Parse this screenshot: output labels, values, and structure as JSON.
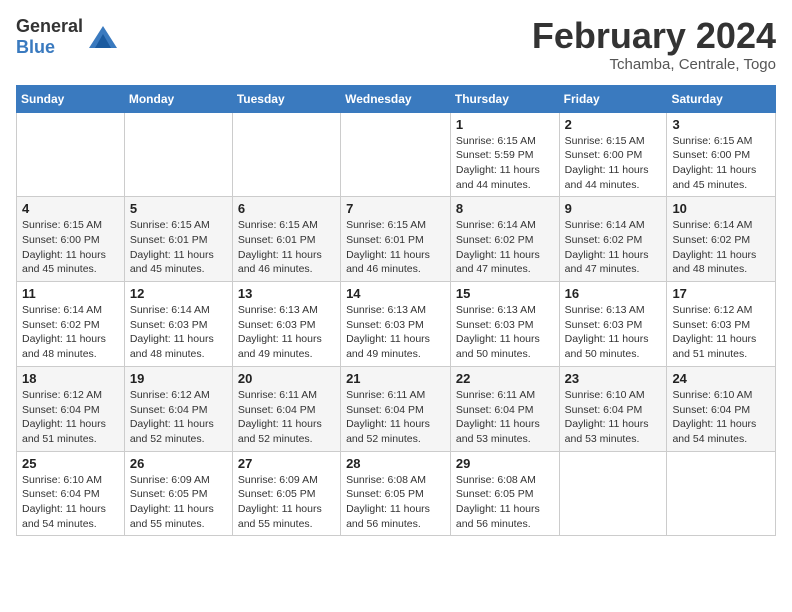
{
  "header": {
    "logo_general": "General",
    "logo_blue": "Blue",
    "month_title": "February 2024",
    "location": "Tchamba, Centrale, Togo"
  },
  "days_of_week": [
    "Sunday",
    "Monday",
    "Tuesday",
    "Wednesday",
    "Thursday",
    "Friday",
    "Saturday"
  ],
  "weeks": [
    [
      {
        "day": "",
        "detail": ""
      },
      {
        "day": "",
        "detail": ""
      },
      {
        "day": "",
        "detail": ""
      },
      {
        "day": "",
        "detail": ""
      },
      {
        "day": "1",
        "detail": "Sunrise: 6:15 AM\nSunset: 5:59 PM\nDaylight: 11 hours\nand 44 minutes."
      },
      {
        "day": "2",
        "detail": "Sunrise: 6:15 AM\nSunset: 6:00 PM\nDaylight: 11 hours\nand 44 minutes."
      },
      {
        "day": "3",
        "detail": "Sunrise: 6:15 AM\nSunset: 6:00 PM\nDaylight: 11 hours\nand 45 minutes."
      }
    ],
    [
      {
        "day": "4",
        "detail": "Sunrise: 6:15 AM\nSunset: 6:00 PM\nDaylight: 11 hours\nand 45 minutes."
      },
      {
        "day": "5",
        "detail": "Sunrise: 6:15 AM\nSunset: 6:01 PM\nDaylight: 11 hours\nand 45 minutes."
      },
      {
        "day": "6",
        "detail": "Sunrise: 6:15 AM\nSunset: 6:01 PM\nDaylight: 11 hours\nand 46 minutes."
      },
      {
        "day": "7",
        "detail": "Sunrise: 6:15 AM\nSunset: 6:01 PM\nDaylight: 11 hours\nand 46 minutes."
      },
      {
        "day": "8",
        "detail": "Sunrise: 6:14 AM\nSunset: 6:02 PM\nDaylight: 11 hours\nand 47 minutes."
      },
      {
        "day": "9",
        "detail": "Sunrise: 6:14 AM\nSunset: 6:02 PM\nDaylight: 11 hours\nand 47 minutes."
      },
      {
        "day": "10",
        "detail": "Sunrise: 6:14 AM\nSunset: 6:02 PM\nDaylight: 11 hours\nand 48 minutes."
      }
    ],
    [
      {
        "day": "11",
        "detail": "Sunrise: 6:14 AM\nSunset: 6:02 PM\nDaylight: 11 hours\nand 48 minutes."
      },
      {
        "day": "12",
        "detail": "Sunrise: 6:14 AM\nSunset: 6:03 PM\nDaylight: 11 hours\nand 48 minutes."
      },
      {
        "day": "13",
        "detail": "Sunrise: 6:13 AM\nSunset: 6:03 PM\nDaylight: 11 hours\nand 49 minutes."
      },
      {
        "day": "14",
        "detail": "Sunrise: 6:13 AM\nSunset: 6:03 PM\nDaylight: 11 hours\nand 49 minutes."
      },
      {
        "day": "15",
        "detail": "Sunrise: 6:13 AM\nSunset: 6:03 PM\nDaylight: 11 hours\nand 50 minutes."
      },
      {
        "day": "16",
        "detail": "Sunrise: 6:13 AM\nSunset: 6:03 PM\nDaylight: 11 hours\nand 50 minutes."
      },
      {
        "day": "17",
        "detail": "Sunrise: 6:12 AM\nSunset: 6:03 PM\nDaylight: 11 hours\nand 51 minutes."
      }
    ],
    [
      {
        "day": "18",
        "detail": "Sunrise: 6:12 AM\nSunset: 6:04 PM\nDaylight: 11 hours\nand 51 minutes."
      },
      {
        "day": "19",
        "detail": "Sunrise: 6:12 AM\nSunset: 6:04 PM\nDaylight: 11 hours\nand 52 minutes."
      },
      {
        "day": "20",
        "detail": "Sunrise: 6:11 AM\nSunset: 6:04 PM\nDaylight: 11 hours\nand 52 minutes."
      },
      {
        "day": "21",
        "detail": "Sunrise: 6:11 AM\nSunset: 6:04 PM\nDaylight: 11 hours\nand 52 minutes."
      },
      {
        "day": "22",
        "detail": "Sunrise: 6:11 AM\nSunset: 6:04 PM\nDaylight: 11 hours\nand 53 minutes."
      },
      {
        "day": "23",
        "detail": "Sunrise: 6:10 AM\nSunset: 6:04 PM\nDaylight: 11 hours\nand 53 minutes."
      },
      {
        "day": "24",
        "detail": "Sunrise: 6:10 AM\nSunset: 6:04 PM\nDaylight: 11 hours\nand 54 minutes."
      }
    ],
    [
      {
        "day": "25",
        "detail": "Sunrise: 6:10 AM\nSunset: 6:04 PM\nDaylight: 11 hours\nand 54 minutes."
      },
      {
        "day": "26",
        "detail": "Sunrise: 6:09 AM\nSunset: 6:05 PM\nDaylight: 11 hours\nand 55 minutes."
      },
      {
        "day": "27",
        "detail": "Sunrise: 6:09 AM\nSunset: 6:05 PM\nDaylight: 11 hours\nand 55 minutes."
      },
      {
        "day": "28",
        "detail": "Sunrise: 6:08 AM\nSunset: 6:05 PM\nDaylight: 11 hours\nand 56 minutes."
      },
      {
        "day": "29",
        "detail": "Sunrise: 6:08 AM\nSunset: 6:05 PM\nDaylight: 11 hours\nand 56 minutes."
      },
      {
        "day": "",
        "detail": ""
      },
      {
        "day": "",
        "detail": ""
      }
    ]
  ]
}
